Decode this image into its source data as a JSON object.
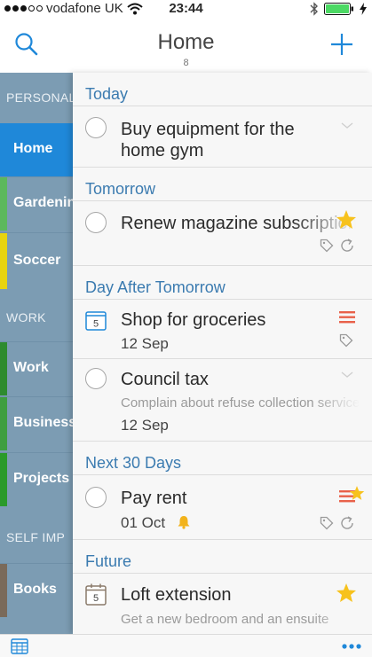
{
  "status_bar": {
    "carrier": "vodafone UK",
    "time": "23:44"
  },
  "nav": {
    "title": "Home",
    "count": "8"
  },
  "sidebar": {
    "headers": [
      "PERSONAL",
      "WORK",
      "SELF IMP"
    ],
    "items": [
      {
        "label": "Home",
        "color": "#1f88d9"
      },
      {
        "label": "Gardening",
        "color": "#5cb85c"
      },
      {
        "label": "Soccer",
        "color": "#e8d40f"
      },
      {
        "label": "Work",
        "color": "#2e8b2e"
      },
      {
        "label": "Business",
        "color": "#3f9e3f"
      },
      {
        "label": "Projects",
        "color": "#2a9a2a"
      },
      {
        "label": "Books",
        "color": "#7a6a5a"
      }
    ]
  },
  "sections": [
    {
      "label": "Today"
    },
    {
      "label": "Tomorrow"
    },
    {
      "label": "Day After Tomorrow"
    },
    {
      "label": "Next 30 Days"
    },
    {
      "label": "Future"
    }
  ],
  "tasks": [
    {
      "title": "Buy equipment for the home gym"
    },
    {
      "title": "Renew magazine subscription"
    },
    {
      "title": "Shop for groceries",
      "date": "12 Sep",
      "cal_day": "5"
    },
    {
      "title": "Council tax",
      "note": "Complain about refuse collection service",
      "date": "12 Sep"
    },
    {
      "title": "Pay rent",
      "date": "01 Oct"
    },
    {
      "title": "Loft extension",
      "note": "Get a new bedroom and an ensuite",
      "cal_day": "5"
    }
  ],
  "colors": {
    "accent": "#1f88d9",
    "section_text": "#3b7bb0",
    "priority": "#e8614a",
    "star": "#f7c21d",
    "bell": "#f2b31b"
  }
}
